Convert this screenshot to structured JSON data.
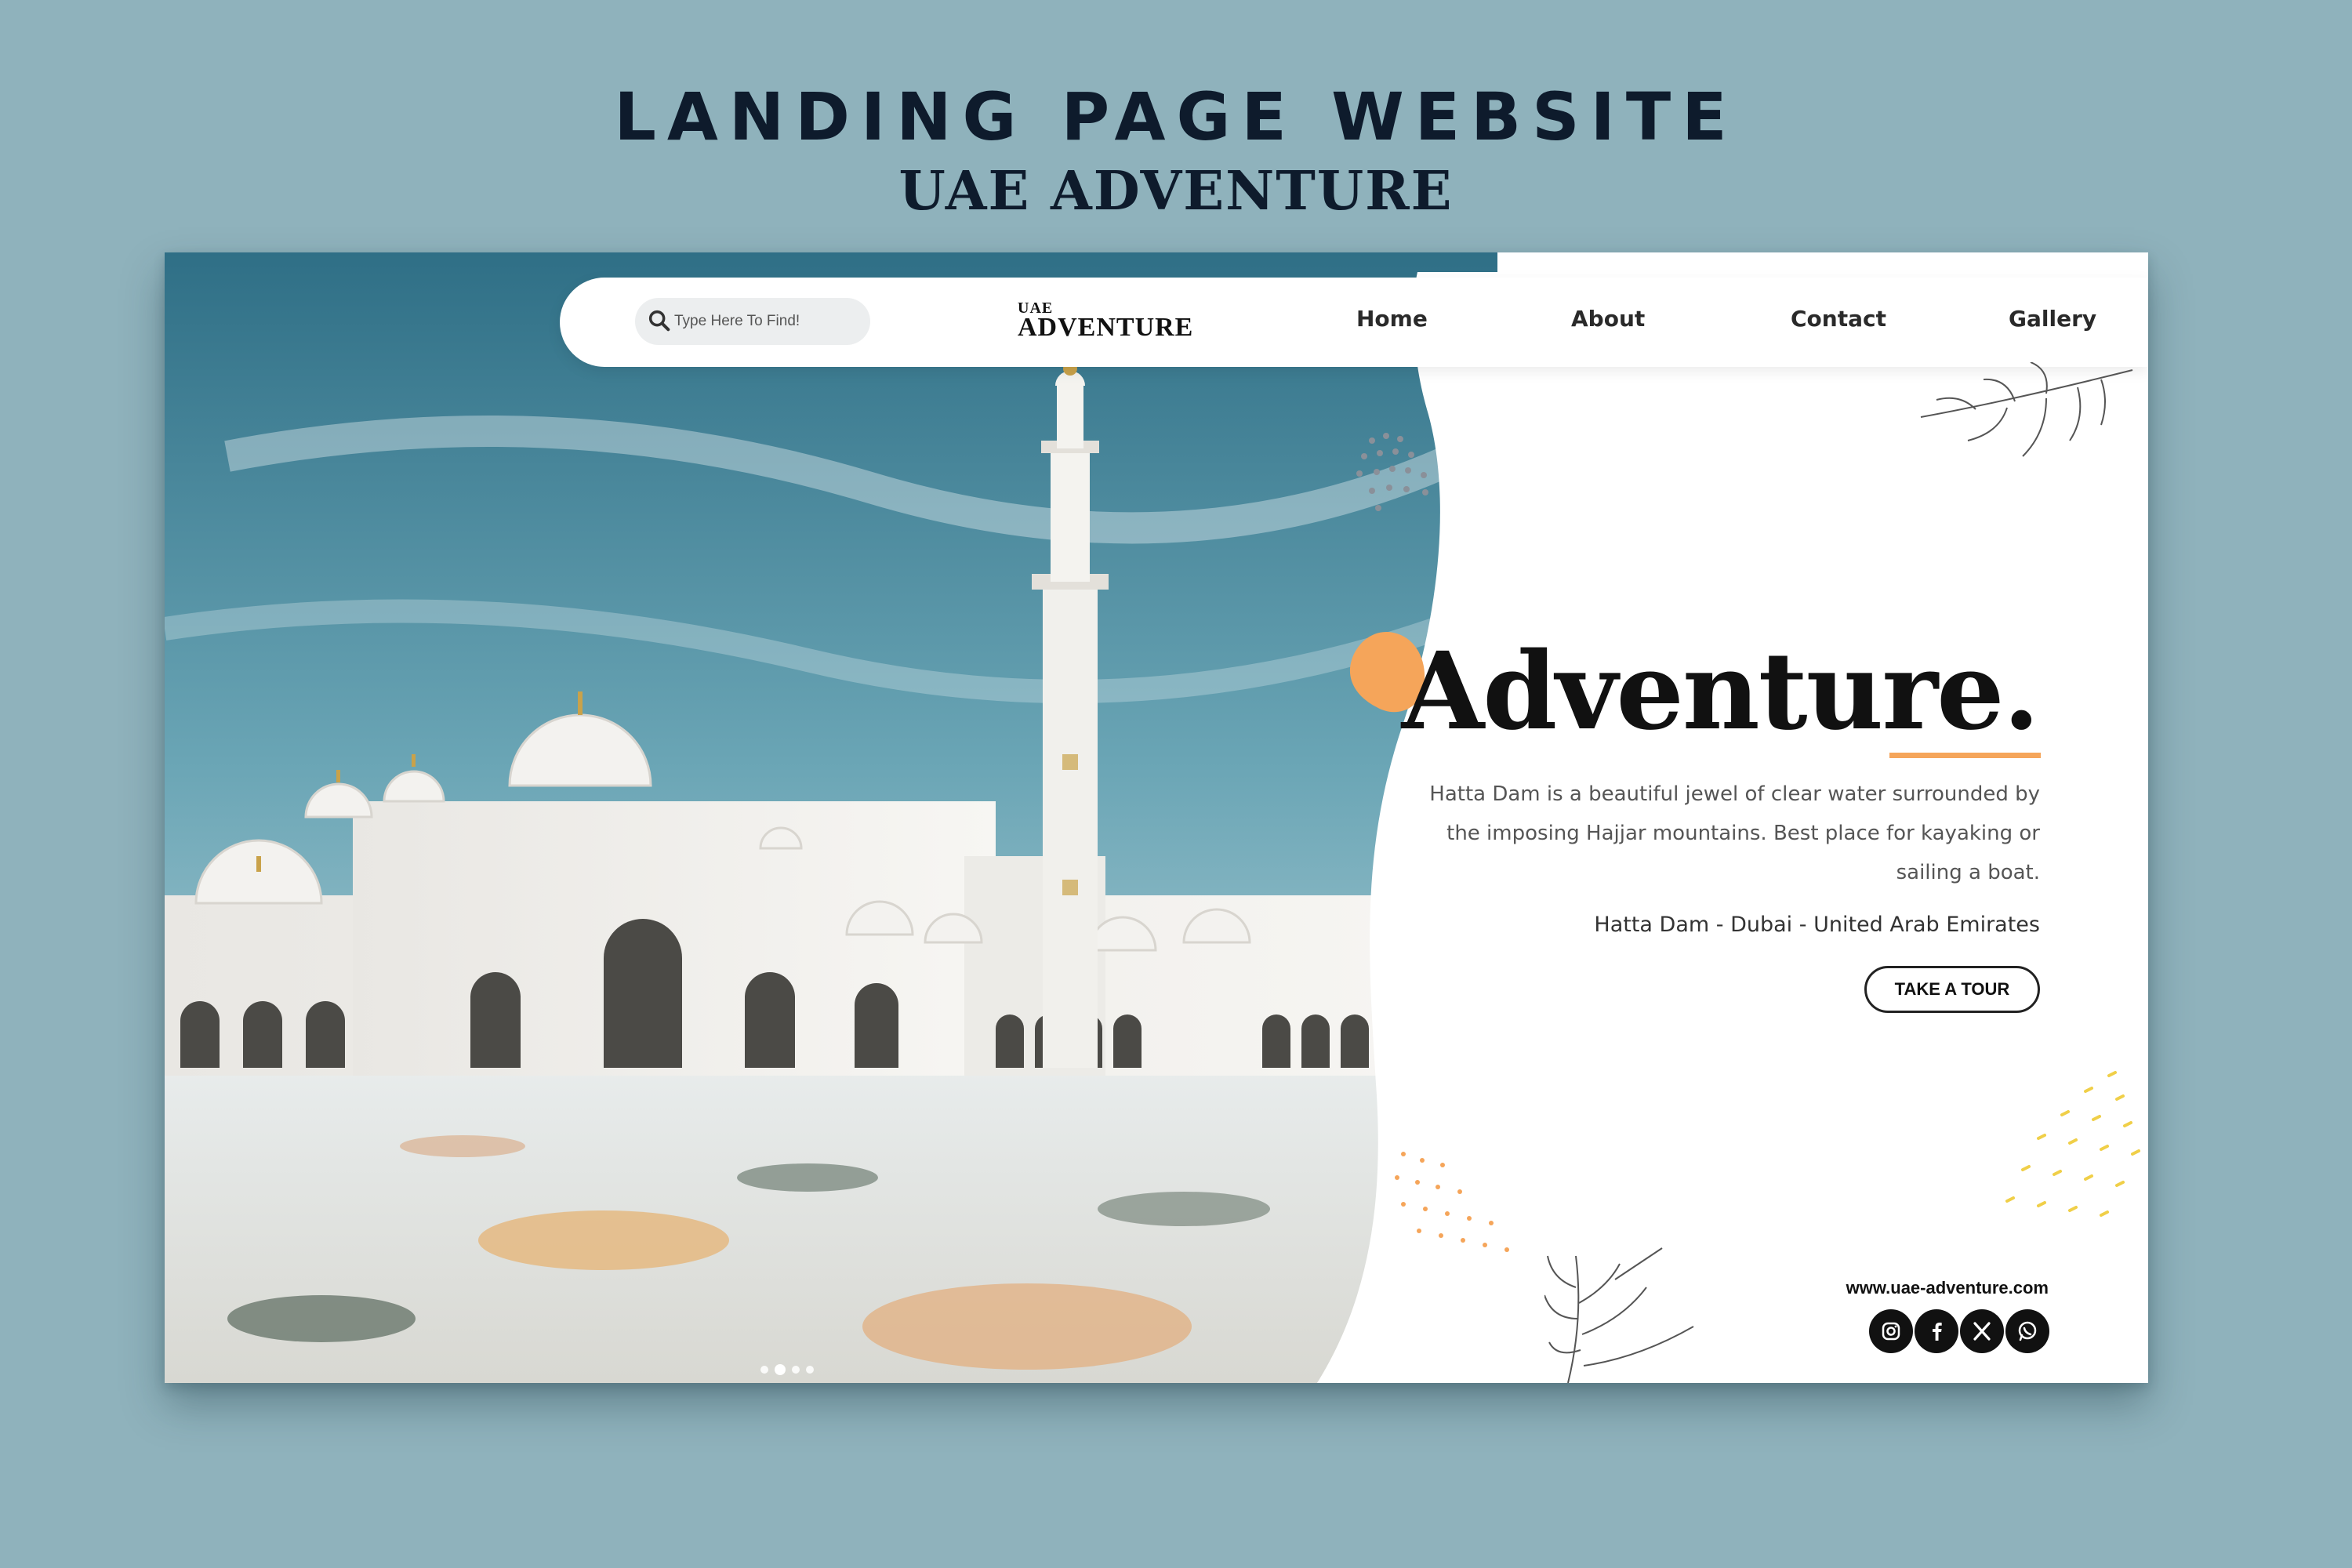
{
  "showcase": {
    "title": "LANDING PAGE WEBSITE",
    "subtitle": "UAE ADVENTURE"
  },
  "search": {
    "placeholder": "Type Here To Find!"
  },
  "logo": {
    "line1": "UAE",
    "line2": "ADVENTURE"
  },
  "nav": {
    "items": [
      {
        "label": "Home"
      },
      {
        "label": "About"
      },
      {
        "label": "Contact"
      },
      {
        "label": "Gallery"
      }
    ]
  },
  "hero": {
    "title": "Adventure.",
    "description": "Hatta Dam is a beautiful jewel of clear water surrounded by the imposing Hajjar mountains. Best place for kayaking or sailing a boat.",
    "location": "Hatta Dam - Dubai - United Arab Emirates",
    "cta_label": "TAKE A TOUR"
  },
  "footer": {
    "url": "www.uae-adventure.com",
    "social": [
      "instagram-icon",
      "facebook-icon",
      "x-icon",
      "whatsapp-icon"
    ]
  },
  "carousel": {
    "count": 4,
    "active": 2
  },
  "colors": {
    "background": "#8fb2bc",
    "accent": "#f5a55a",
    "text_dark": "#111111",
    "sky": "#4e8ea3"
  }
}
